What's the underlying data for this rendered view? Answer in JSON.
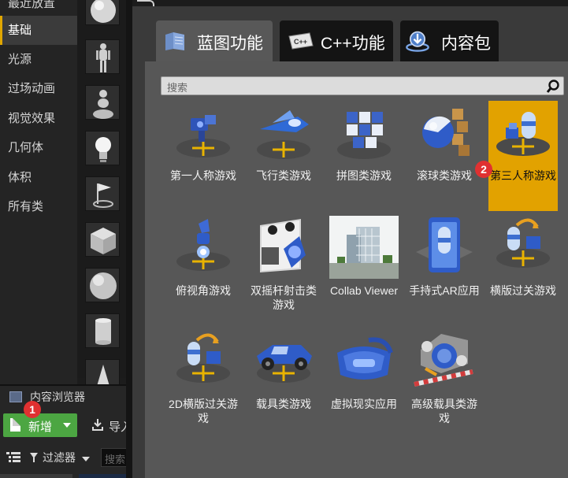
{
  "place_panel": {
    "categories": [
      {
        "label": "最近放置",
        "active": false
      },
      {
        "label": "基础",
        "active": true
      },
      {
        "label": "光源",
        "active": false
      },
      {
        "label": "过场动画",
        "active": false
      },
      {
        "label": "视觉效果",
        "active": false
      },
      {
        "label": "几何体",
        "active": false
      },
      {
        "label": "体积",
        "active": false
      },
      {
        "label": "所有类",
        "active": false
      }
    ],
    "asset_icons": [
      "sphere-icon",
      "mannequin-icon",
      "pawn-icon",
      "light-bulb-icon",
      "player-start-flag-icon",
      "cube-icon",
      "sphere-icon",
      "cylinder-icon",
      "cone-icon"
    ]
  },
  "content_browser": {
    "title": "内容浏览器",
    "new_button": "新增",
    "import_button": "导入",
    "filter_label": "过滤器",
    "search_placeholder": "搜索"
  },
  "dialog": {
    "tabs": [
      {
        "label": "蓝图功能",
        "icon": "blueprint-icon",
        "active": true
      },
      {
        "label": "C++功能",
        "icon": "cpp-icon",
        "active": false
      },
      {
        "label": "内容包",
        "icon": "content-pack-icon",
        "active": false
      }
    ],
    "search_placeholder": "搜索",
    "templates": [
      {
        "label": "第一人称游戏",
        "icon": "first-person-icon",
        "selected": false
      },
      {
        "label": "飞行类游戏",
        "icon": "flying-icon",
        "selected": false
      },
      {
        "label": "拼图类游戏",
        "icon": "puzzle-icon",
        "selected": false
      },
      {
        "label": "滚球类游戏",
        "icon": "rolling-ball-icon",
        "selected": false
      },
      {
        "label": "第三人称游戏",
        "icon": "third-person-icon",
        "selected": true
      },
      {
        "label": "俯视角游戏",
        "icon": "top-down-icon",
        "selected": false
      },
      {
        "label": "双摇杆射击类游戏",
        "icon": "twin-stick-icon",
        "selected": false
      },
      {
        "label": "Collab Viewer",
        "icon": "collab-viewer-icon",
        "selected": false
      },
      {
        "label": "手持式AR应用",
        "icon": "handheld-ar-icon",
        "selected": false
      },
      {
        "label": "横版过关游戏",
        "icon": "side-scroller-icon",
        "selected": false
      },
      {
        "label": "2D横版过关游戏",
        "icon": "side-scroller-2d-icon",
        "selected": false
      },
      {
        "label": "载具类游戏",
        "icon": "vehicle-icon",
        "selected": false
      },
      {
        "label": "虚拟现实应用",
        "icon": "vr-headset-icon",
        "selected": false
      },
      {
        "label": "高级载具类游戏",
        "icon": "advanced-vehicle-icon",
        "selected": false
      }
    ]
  },
  "badges": {
    "first": "1",
    "second": "2"
  },
  "colors": {
    "selected_tile": "#e2a200",
    "new_button": "#4ca642",
    "badge": "#e03131",
    "active_category_bar": "#e0a600"
  }
}
